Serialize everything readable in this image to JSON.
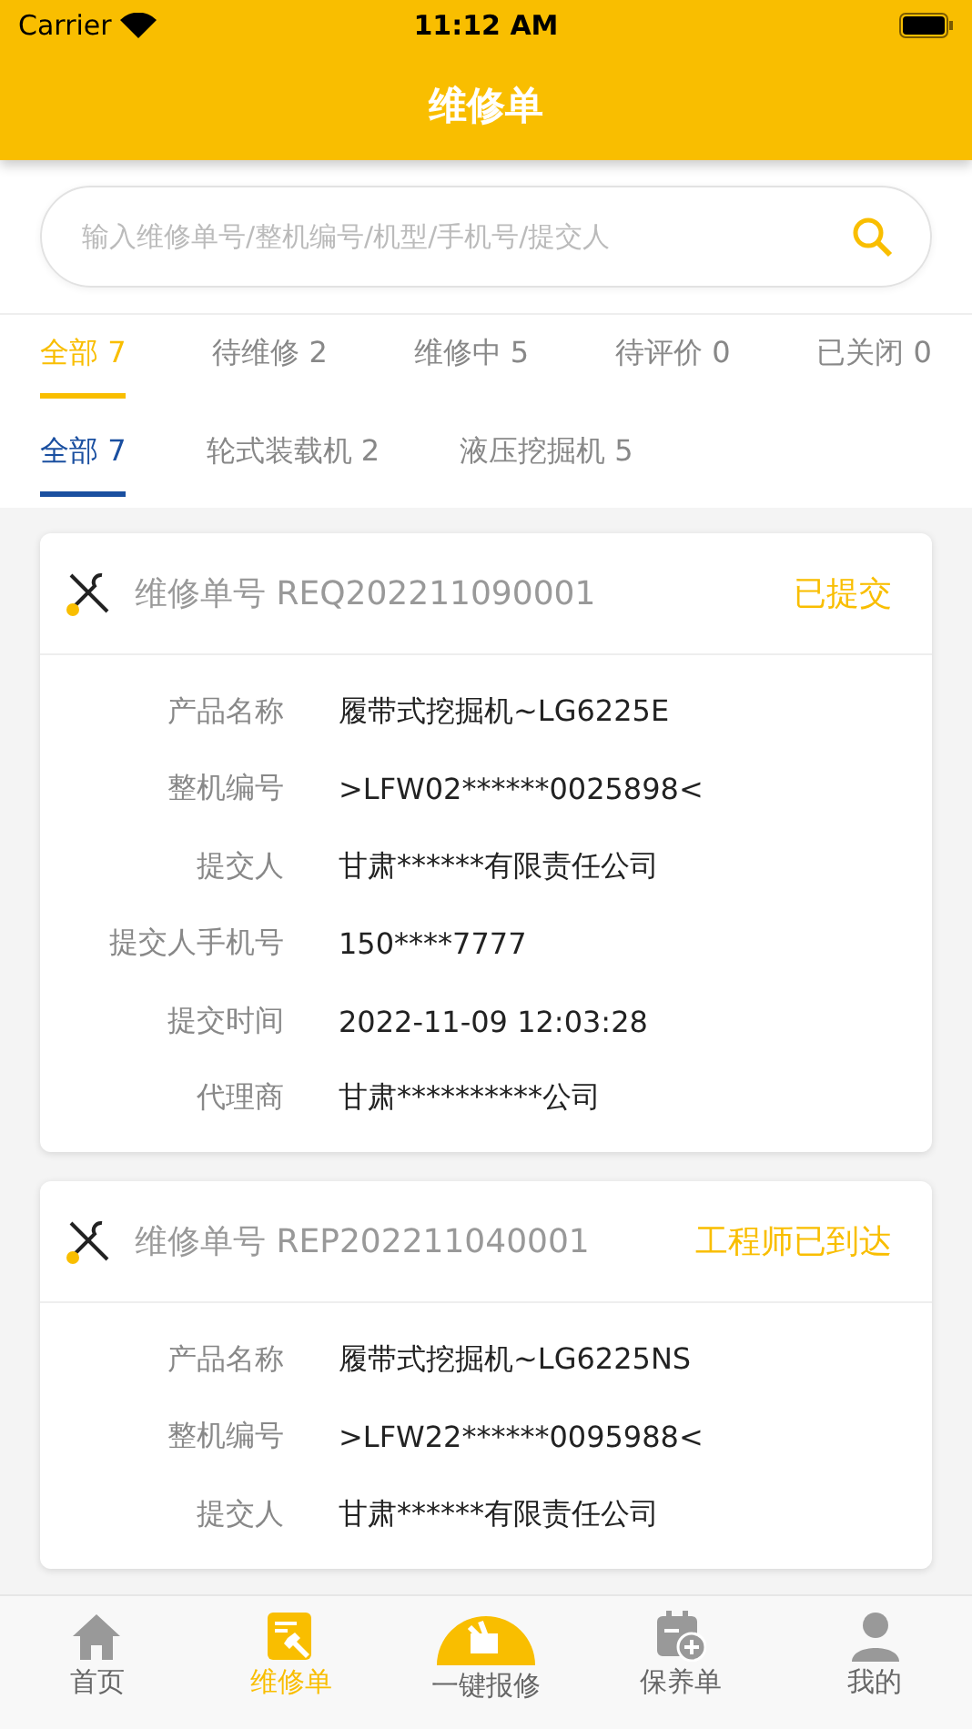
{
  "status_bar": {
    "carrier": "Carrier",
    "time": "11:12 AM"
  },
  "header": {
    "title": "维修单"
  },
  "search": {
    "placeholder": "输入维修单号/整机编号/机型/手机号/提交人"
  },
  "status_tabs": [
    {
      "label": "全部 7",
      "selected": true
    },
    {
      "label": "待维修 2",
      "selected": false
    },
    {
      "label": "维修中 5",
      "selected": false
    },
    {
      "label": "待评价 0",
      "selected": false
    },
    {
      "label": "已关闭 0",
      "selected": false
    }
  ],
  "category_tabs": [
    {
      "label": "全部 7",
      "selected": true
    },
    {
      "label": "轮式装载机 2",
      "selected": false
    },
    {
      "label": "液压挖掘机 5",
      "selected": false
    }
  ],
  "orders": [
    {
      "number": "维修单号 REQ202211090001",
      "status": "已提交",
      "fields": [
        {
          "label": "产品名称",
          "value": "履带式挖掘机~LG6225E"
        },
        {
          "label": "整机编号",
          "value": ">LFW02******0025898<"
        },
        {
          "label": "提交人",
          "value": "甘肃******有限责任公司"
        },
        {
          "label": "提交人手机号",
          "value": "150****7777"
        },
        {
          "label": "提交时间",
          "value": "2022-11-09 12:03:28"
        },
        {
          "label": "代理商",
          "value": "甘肃**********公司"
        }
      ]
    },
    {
      "number": "维修单号 REP202211040001",
      "status": "工程师已到达",
      "fields": [
        {
          "label": "产品名称",
          "value": "履带式挖掘机~LG6225NS"
        },
        {
          "label": "整机编号",
          "value": ">LFW22******0095988<"
        },
        {
          "label": "提交人",
          "value": "甘肃******有限责任公司"
        }
      ]
    }
  ],
  "tab_bar": [
    {
      "label": "首页",
      "kind": "home",
      "selected": false
    },
    {
      "label": "维修单",
      "kind": "orders",
      "selected": true
    },
    {
      "label": "一键报修",
      "kind": "report",
      "selected": false
    },
    {
      "label": "保养单",
      "kind": "maintenance",
      "selected": false
    },
    {
      "label": "我的",
      "kind": "profile",
      "selected": false
    }
  ]
}
